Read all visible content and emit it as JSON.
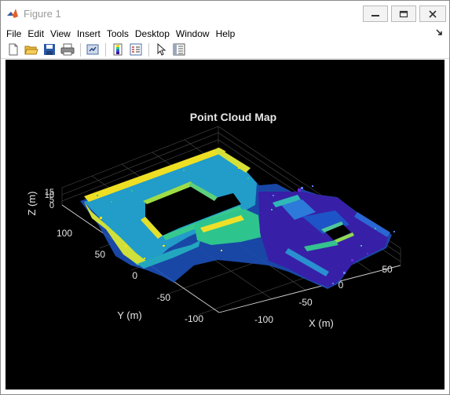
{
  "window": {
    "title": "Figure 1",
    "controls": {
      "minimize": "minimize",
      "maximize": "maximize",
      "close": "close"
    }
  },
  "menu": {
    "items": [
      "File",
      "Edit",
      "View",
      "Insert",
      "Tools",
      "Desktop",
      "Window",
      "Help"
    ]
  },
  "toolbar": {
    "buttons": [
      "new-figure-icon",
      "open-file-icon",
      "save-icon",
      "print-icon",
      "link-plot-icon",
      "colorbar-icon",
      "legend-icon",
      "pointer-icon",
      "property-inspector-icon"
    ]
  },
  "plot": {
    "title": "Point Cloud Map",
    "xlabel": "X (m)",
    "ylabel": "Y (m)",
    "zlabel": "Z (m)",
    "x_ticks": [
      "-100",
      "0",
      "50"
    ],
    "y_ticks": [
      "100",
      "50",
      "0",
      "-50",
      "-100"
    ],
    "z_ticks": [
      "15",
      "10",
      "5",
      "0"
    ]
  },
  "colors": {
    "background": "#000000",
    "axis_text": "#e6e6e6",
    "colormap": [
      "#3b0f9a",
      "#2a57d6",
      "#1fa0c7",
      "#2fc58f",
      "#9fdc43",
      "#f0e01f"
    ]
  }
}
